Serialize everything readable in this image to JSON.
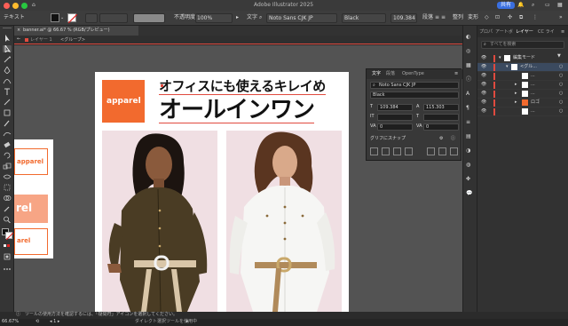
{
  "app": {
    "title": "Adobe Illustrator 2025",
    "share_label": "共有"
  },
  "control_bar": {
    "selection_label": "テキスト",
    "opacity_label": "不透明度",
    "opacity_value": "100%",
    "char_label": "文字",
    "font_name": "Noto Sans CJK JP",
    "font_weight": "Black",
    "font_size": "109.384",
    "para_label": "段落",
    "align_label": "整列",
    "transform_label": "変形"
  },
  "document": {
    "tab_title": "banner.ai* @ 66.67 % (RGB/プレビュー)",
    "breadcrumb_layer": "レイヤー 1",
    "breadcrumb_group": "<グループ>"
  },
  "artboard": {
    "logo_text": "apparel",
    "headline_small": "オフィスにも使えるキレイめ",
    "headline_large": "オールインワン"
  },
  "side_canvas": {
    "logo_outline_1": "apparel",
    "logo_fill": "rel",
    "logo_outline_2": "arel"
  },
  "char_panel": {
    "tabs": [
      "文字",
      "段落",
      "OpenType"
    ],
    "font_name": "Noto Sans CJK JP",
    "font_style": "Black",
    "size": "109.384",
    "leading": "115.303",
    "kerning": "0",
    "tracking": "0",
    "snap_label": "グリフにスナップ"
  },
  "right_panel": {
    "tabs": [
      "プロパ",
      "アートボ",
      "レイヤー",
      "CC ライ"
    ],
    "search_placeholder": "すべてを検索",
    "layers": [
      {
        "name": "編集モード"
      },
      {
        "name": "<グル..."
      },
      {
        "name": "..."
      },
      {
        "name": "..."
      },
      {
        "name": "..."
      },
      {
        "name": "ロゴ"
      },
      {
        "name": "..."
      }
    ]
  },
  "status_bar": {
    "hint": "ツールの使用方法を確認するには、「疑問符」アイコンを選択してください。",
    "zoom": "66.67%",
    "tool_name": "ダイレクト選択ツールを使用中"
  },
  "colors": {
    "brand_orange": "#f26a2e",
    "photo_bg": "#f0dfe3",
    "accent_red": "#e04a3f"
  }
}
